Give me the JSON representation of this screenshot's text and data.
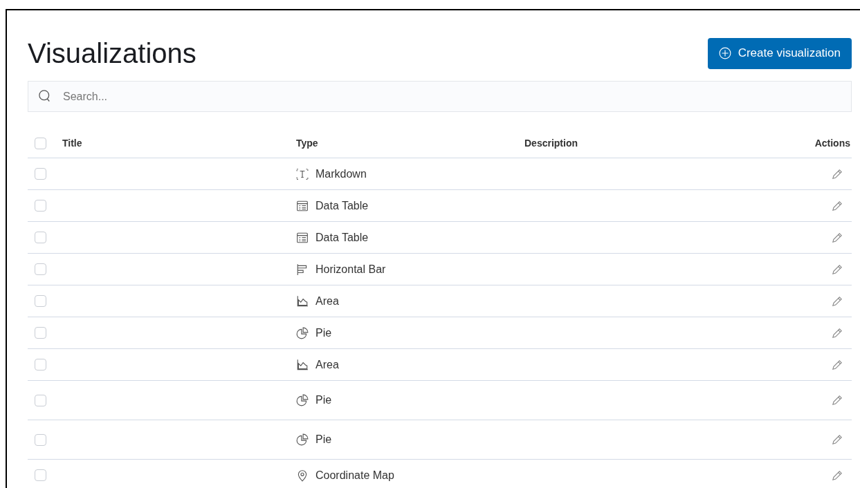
{
  "page": {
    "title": "Visualizations",
    "create_button": "Create visualization"
  },
  "search": {
    "placeholder": "Search..."
  },
  "table": {
    "columns": [
      "Title",
      "Type",
      "Description",
      "Actions"
    ],
    "select_all": {
      "checked": false
    },
    "rows": [
      {
        "checked": false,
        "kind": "markdown",
        "type": "Markdown",
        "tall": false
      },
      {
        "checked": false,
        "kind": "table",
        "type": "Data Table",
        "tall": false
      },
      {
        "checked": false,
        "kind": "table",
        "type": "Data Table",
        "tall": false
      },
      {
        "checked": false,
        "kind": "hbar",
        "type": "Horizontal Bar",
        "tall": false
      },
      {
        "checked": false,
        "kind": "area",
        "type": "Area",
        "tall": false
      },
      {
        "checked": false,
        "kind": "pie",
        "type": "Pie",
        "tall": false
      },
      {
        "checked": false,
        "kind": "area",
        "type": "Area",
        "tall": false
      },
      {
        "checked": false,
        "kind": "pie",
        "type": "Pie",
        "tall": true
      },
      {
        "checked": false,
        "kind": "pie",
        "type": "Pie",
        "tall": true
      },
      {
        "checked": false,
        "kind": "map",
        "type": "Coordinate Map",
        "tall": false
      }
    ]
  }
}
